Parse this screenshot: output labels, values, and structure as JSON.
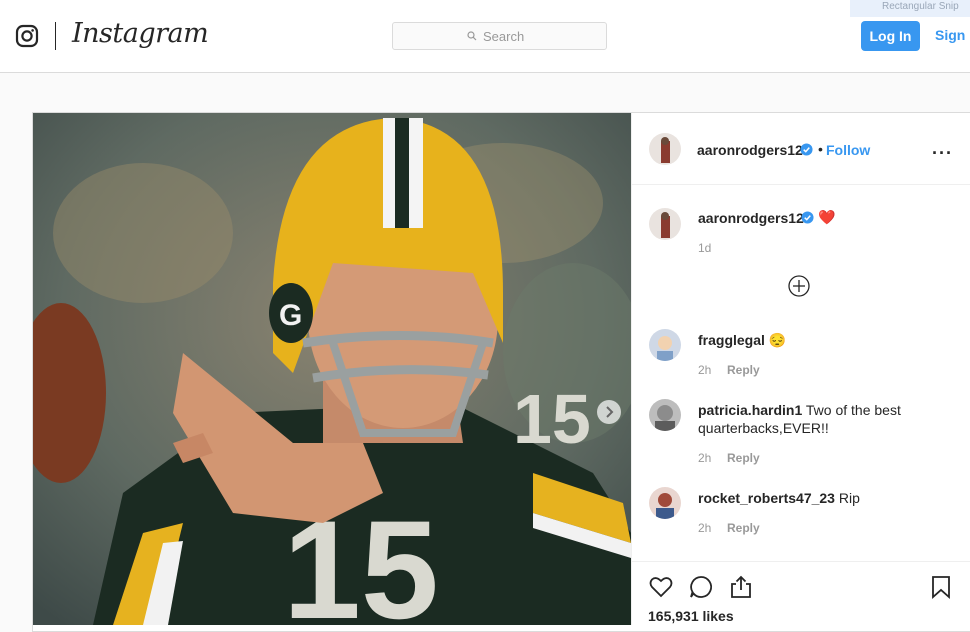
{
  "header": {
    "brand": "Instagram",
    "search_placeholder": "Search",
    "login_label": "Log In",
    "signup_label": "Sign Up",
    "snip_label": "Rectangular Snip"
  },
  "post": {
    "author": "aaronrodgers12",
    "follow_label": "Follow",
    "caption_author": "aaronrodgers12",
    "caption_emoji": "❤️",
    "caption_time": "1d",
    "comments": [
      {
        "user": "fragglegal",
        "text": "😔",
        "time": "2h",
        "reply": "Reply"
      },
      {
        "user": "patricia.hardin1",
        "text": "Two of the best quarterbacks,EVER!!",
        "time": "2h",
        "reply": "Reply"
      },
      {
        "user": "rocket_roberts47_23",
        "text": "Rip",
        "time": "2h",
        "reply": "Reply"
      }
    ],
    "likes": "165,931 likes"
  },
  "colors": {
    "accent": "#3897f0",
    "border": "#dbdbdb",
    "text": "#262626",
    "muted": "#999999"
  },
  "icons": [
    "instagram-glyph-icon",
    "search-icon",
    "verified-badge-icon",
    "more-options-icon",
    "add-comment-icon",
    "heart-icon",
    "comment-icon",
    "share-icon",
    "bookmark-icon",
    "next-arrow-icon"
  ]
}
